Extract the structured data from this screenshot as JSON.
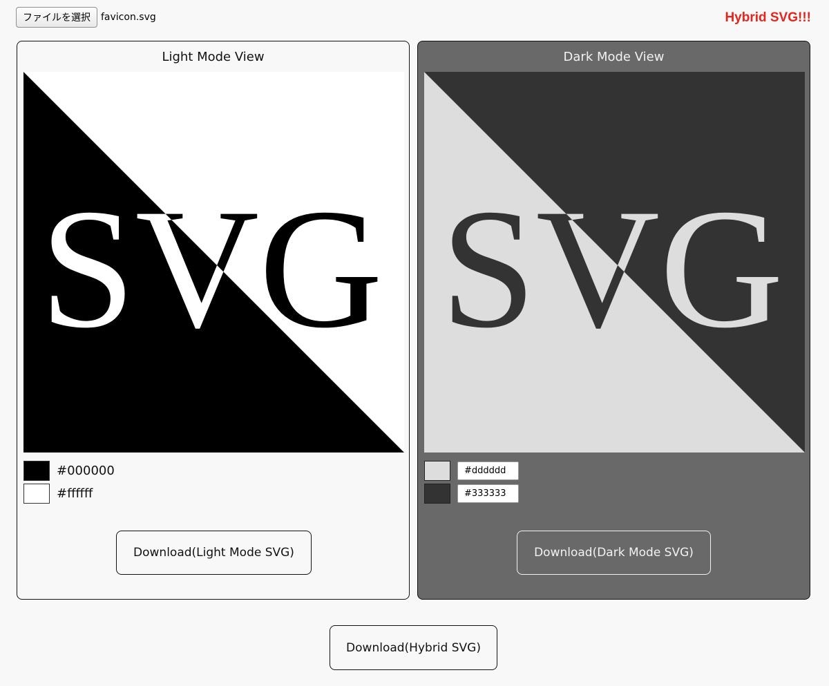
{
  "file_picker": {
    "button_label": "ファイルを選択",
    "file_name": "favicon.svg"
  },
  "header": {
    "title": "Hybrid SVG!!!",
    "title_color": "#e8231d"
  },
  "preview_text": "SVG",
  "light_panel": {
    "title": "Light Mode View",
    "colors": [
      {
        "label": "#000000",
        "swatch": "#000000"
      },
      {
        "label": "#ffffff",
        "swatch": "#ffffff"
      }
    ],
    "download_label": "Download(Light Mode SVG)",
    "background": "#f8f8f8"
  },
  "dark_panel": {
    "title": "Dark Mode View",
    "colors": [
      {
        "value": "#dddddd",
        "swatch": "#dddddd"
      },
      {
        "value": "#333333",
        "swatch": "#333333"
      }
    ],
    "download_label": "Download(Dark Mode SVG)",
    "background": "#696969"
  },
  "hybrid_download_label": "Download(Hybrid SVG)"
}
